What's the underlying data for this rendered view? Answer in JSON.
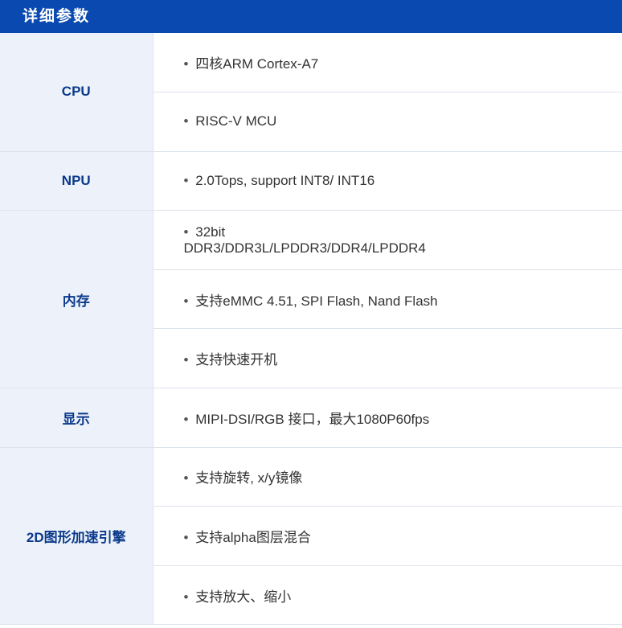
{
  "header": {
    "title": "详细参数"
  },
  "bullet_char": "•",
  "groups": [
    {
      "label": "CPU",
      "items": [
        "四核ARM Cortex-A7",
        "RISC-V MCU"
      ]
    },
    {
      "label": "NPU",
      "items": [
        "2.0Tops, support INT8/ INT16"
      ]
    },
    {
      "label": "内存",
      "items": [
        "32bit DDR3/DDR3L/LPDDR3/DDR4/LPDDR4",
        "支持eMMC 4.51, SPI Flash, Nand Flash",
        "支持快速开机"
      ]
    },
    {
      "label": "显示",
      "items": [
        "MIPI-DSI/RGB 接口，最大1080P60fps"
      ]
    },
    {
      "label": "2D图形加速引擎",
      "items": [
        "支持旋转, x/y镜像",
        "支持alpha图层混合",
        "支持放大、缩小"
      ]
    }
  ],
  "colors": {
    "header_bg": "#0a4ab0",
    "label_bg": "#edf2fa",
    "label_text": "#0b3a8c",
    "value_text": "#333333",
    "border": "#dde3ec"
  }
}
